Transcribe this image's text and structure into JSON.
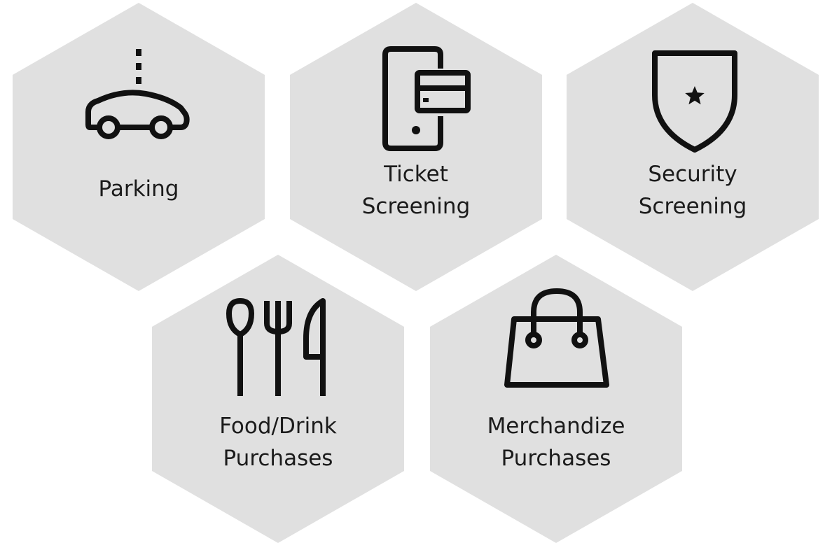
{
  "colors": {
    "hexagon_fill": "#e0e0e0",
    "icon_stroke": "#111111",
    "label_text": "#1b1b1b"
  },
  "tiles": [
    {
      "icon": "parking-car-icon",
      "label": "Parking"
    },
    {
      "icon": "mobile-ticket-icon",
      "label": "Ticket\nScreening"
    },
    {
      "icon": "security-shield-icon",
      "label": "Security\nScreening"
    },
    {
      "icon": "food-drink-utensils-icon",
      "label": "Food/Drink\nPurchases"
    },
    {
      "icon": "shopping-bag-icon",
      "label": "Merchandize\nPurchases"
    }
  ]
}
